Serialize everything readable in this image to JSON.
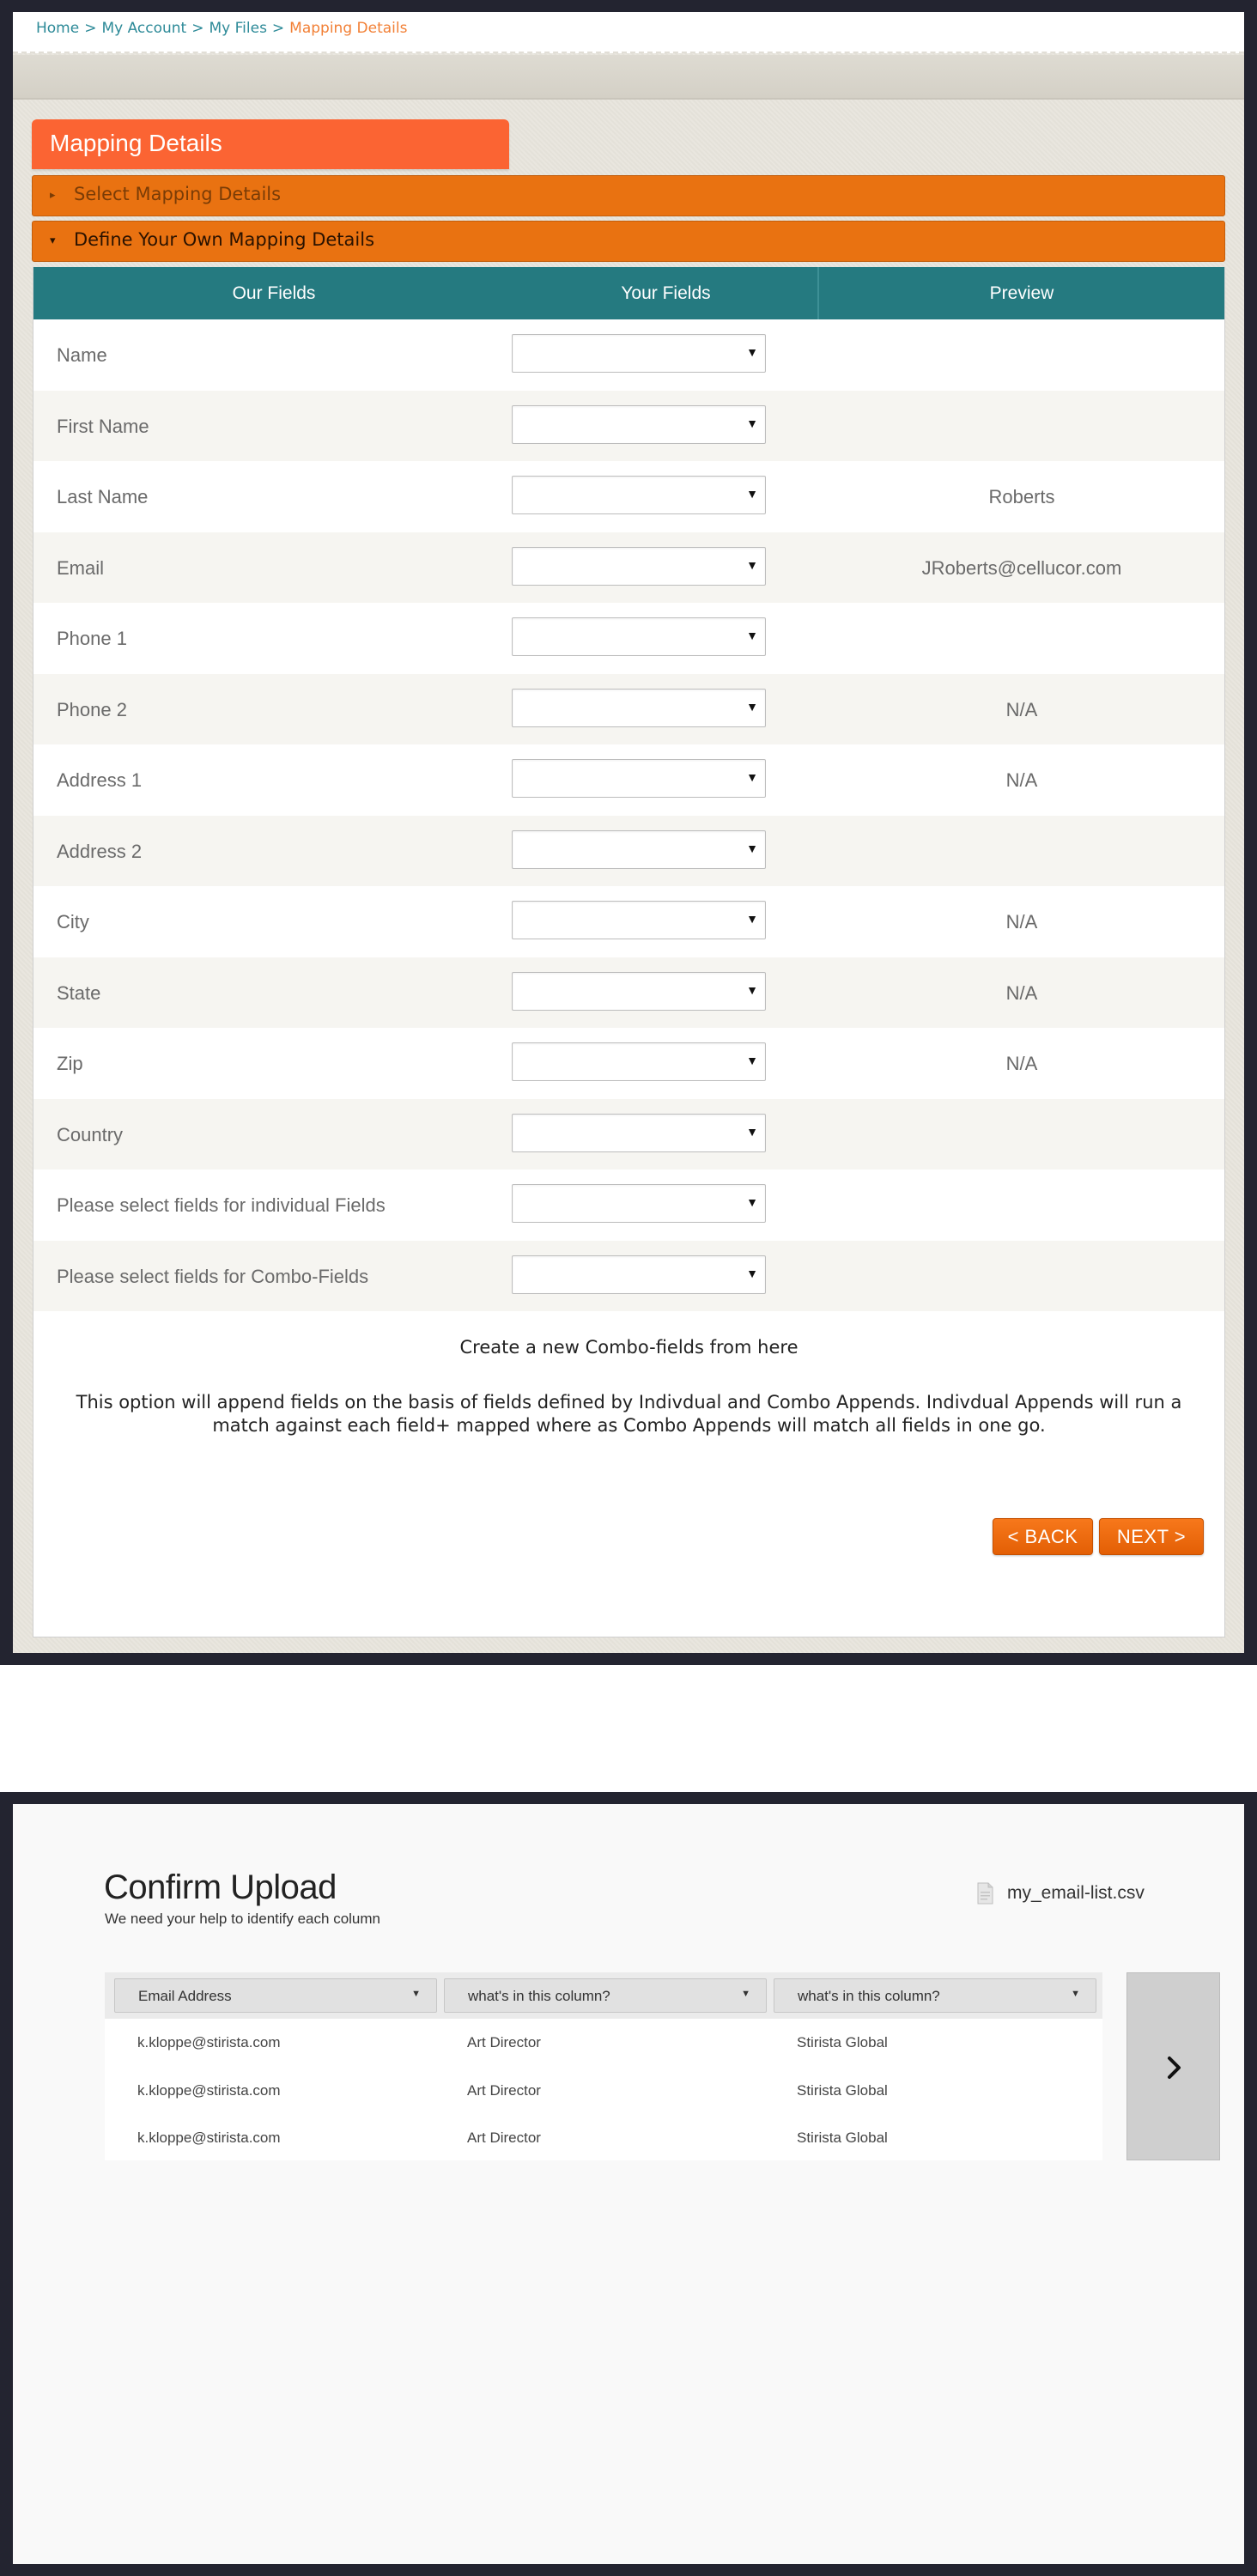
{
  "mapping": {
    "breadcrumb": [
      {
        "label": "Home"
      },
      {
        "label": "My Account"
      },
      {
        "label": "My Files"
      },
      {
        "label": "Mapping Details"
      }
    ],
    "breadcrumb_separator": ">",
    "page_title": "Mapping Details",
    "accordion": [
      {
        "label": "Select Mapping Details",
        "state": "collapsed"
      },
      {
        "label": "Define Your Own Mapping Details",
        "state": "expanded"
      }
    ],
    "table": {
      "headers": {
        "our_fields": "Our Fields",
        "your_fields": "Your Fields",
        "preview": "Preview"
      },
      "rows": [
        {
          "field": "Name",
          "selected": "",
          "preview": ""
        },
        {
          "field": "First Name",
          "selected": "",
          "preview": ""
        },
        {
          "field": "Last Name",
          "selected": "",
          "preview": "Roberts"
        },
        {
          "field": "Email",
          "selected": "",
          "preview": "JRoberts@cellucor.com"
        },
        {
          "field": "Phone 1",
          "selected": "",
          "preview": ""
        },
        {
          "field": "Phone 2",
          "selected": "",
          "preview": "N/A"
        },
        {
          "field": "Address 1",
          "selected": "",
          "preview": "N/A"
        },
        {
          "field": "Address 2",
          "selected": "",
          "preview": ""
        },
        {
          "field": "City",
          "selected": "",
          "preview": "N/A"
        },
        {
          "field": "State",
          "selected": "",
          "preview": "N/A"
        },
        {
          "field": "Zip",
          "selected": "",
          "preview": "N/A"
        },
        {
          "field": "Country",
          "selected": "",
          "preview": ""
        },
        {
          "field": "Please select fields for individual Fields",
          "selected": "",
          "preview": ""
        },
        {
          "field": "Please select fields for Combo-Fields",
          "selected": "",
          "preview": ""
        }
      ]
    },
    "combo_link": "Create a new Combo-fields from here",
    "append_note": "This option will append fields on the basis of fields defined by Indivdual and Combo Appends. Indivdual Appends will run a match against each field+ mapped where as Combo Appends will match all fields in one go.",
    "back_label": "< BACK",
    "next_label": "NEXT >",
    "colors": {
      "accent_orange": "#fb6433",
      "accordion_orange": "#e97211",
      "header_teal": "#257a80",
      "breadcrumb_link": "#2d8a98",
      "breadcrumb_current": "#f28036"
    }
  },
  "confirm": {
    "title": "Confirm Upload",
    "subtitle": "We need your help to identify each column",
    "file_name": "my_email-list.csv",
    "file_icon": "file-icon",
    "columns": [
      {
        "selected": "Email Address"
      },
      {
        "selected": "what's in this column?"
      },
      {
        "selected": "what's in this column?"
      }
    ],
    "rows": [
      [
        "k.kloppe@stirista.com",
        "Art Director",
        "Stirista Global"
      ],
      [
        "k.kloppe@stirista.com",
        "Art Director",
        "Stirista Global"
      ],
      [
        "k.kloppe@stirista.com",
        "Art Director",
        "Stirista Global"
      ]
    ],
    "next_columns_icon": "chevron-right-icon"
  }
}
